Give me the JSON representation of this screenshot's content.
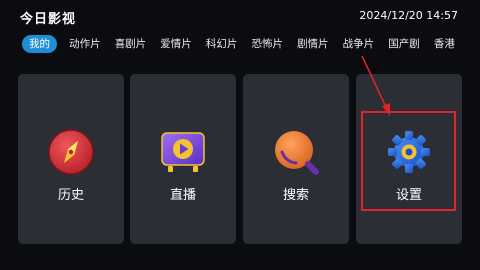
{
  "header": {
    "app_title": "今日影视",
    "datetime": "2024/12/20 14:57"
  },
  "tabs": [
    {
      "label": "我的",
      "active": true
    },
    {
      "label": "动作片",
      "active": false
    },
    {
      "label": "喜剧片",
      "active": false
    },
    {
      "label": "爱情片",
      "active": false
    },
    {
      "label": "科幻片",
      "active": false
    },
    {
      "label": "恐怖片",
      "active": false
    },
    {
      "label": "剧情片",
      "active": false
    },
    {
      "label": "战争片",
      "active": false
    },
    {
      "label": "国产剧",
      "active": false
    },
    {
      "label": "香港",
      "active": false
    }
  ],
  "cards": [
    {
      "label": "历史",
      "icon": "compass-icon"
    },
    {
      "label": "直播",
      "icon": "tv-play-icon"
    },
    {
      "label": "搜索",
      "icon": "magnifier-icon"
    },
    {
      "label": "设置",
      "icon": "gear-icon"
    }
  ],
  "colors": {
    "background": "#0b0c10",
    "card": "#2c2e36",
    "active_tab": "#1e8fd6",
    "annotation": "#e0242b"
  }
}
